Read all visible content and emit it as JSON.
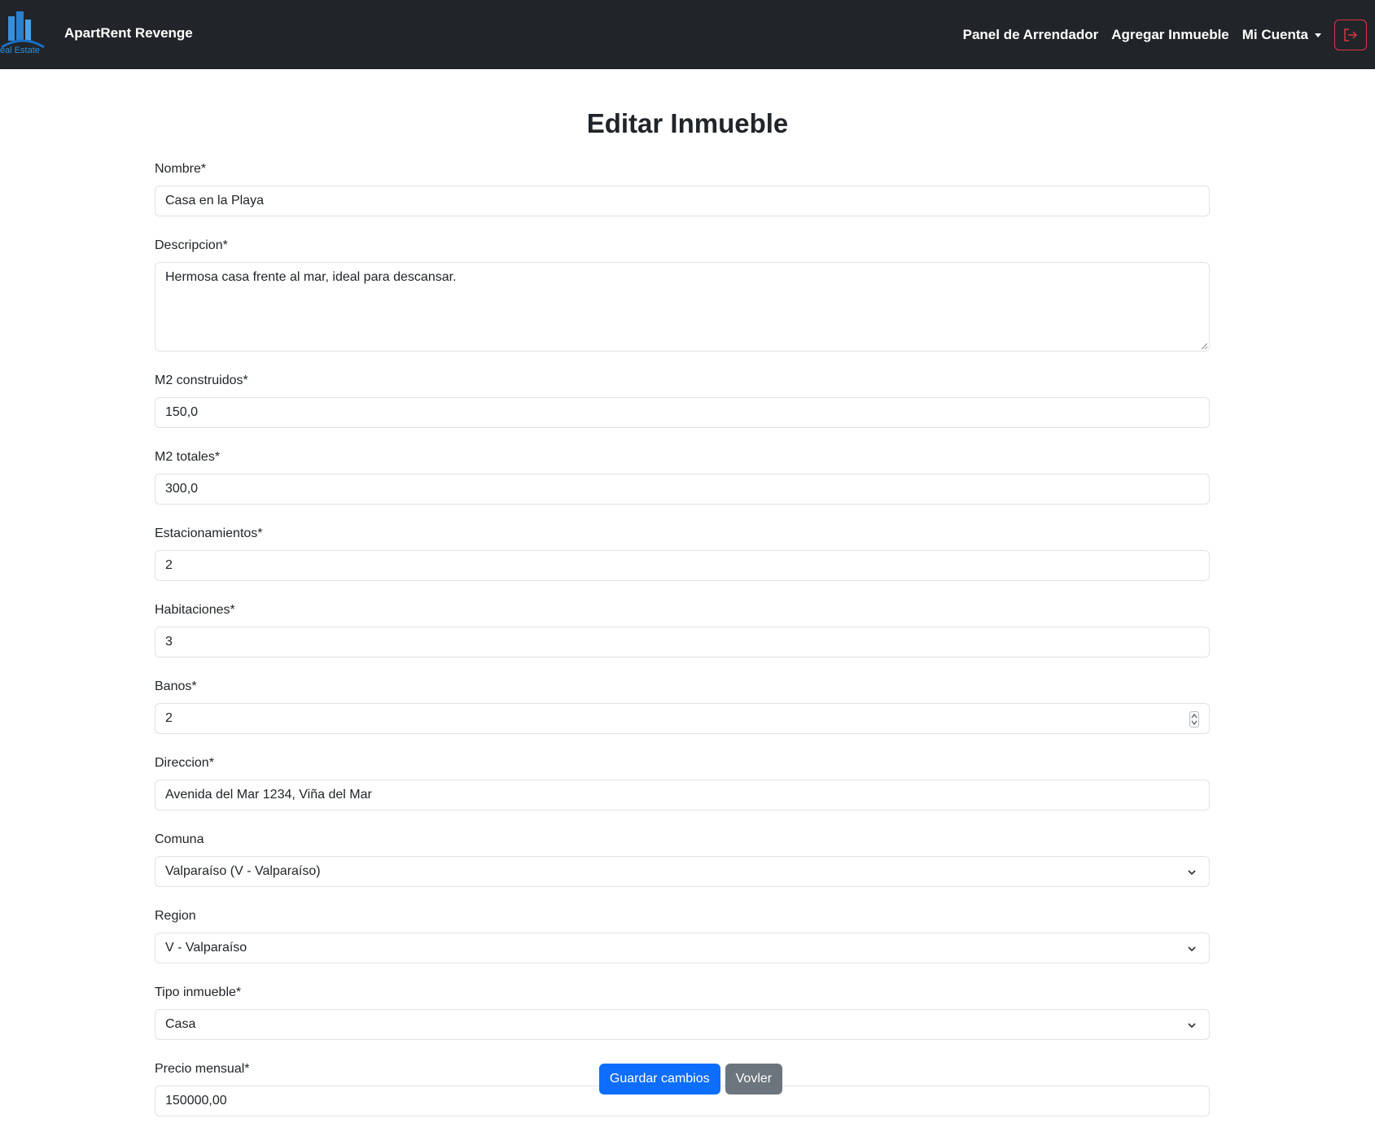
{
  "navbar": {
    "brand": "ApartRent Revenge",
    "logo_text": "Real Estate",
    "links": [
      {
        "label": "Panel de Arrendador"
      },
      {
        "label": "Agregar Inmueble"
      },
      {
        "label": "Mi Cuenta"
      }
    ],
    "logout_icon": "logout-icon",
    "logout_color": "#dc3545"
  },
  "page": {
    "title": "Editar Inmueble"
  },
  "form": {
    "nombre": {
      "label": "Nombre*",
      "value": "Casa en la Playa"
    },
    "descripcion": {
      "label": "Descripcion*",
      "value": "Hermosa casa frente al mar, ideal para descansar."
    },
    "m2_construidos": {
      "label": "M2 construidos*",
      "value": "150,0"
    },
    "m2_totales": {
      "label": "M2 totales*",
      "value": "300,0"
    },
    "estacionamientos": {
      "label": "Estacionamientos*",
      "value": "2"
    },
    "habitaciones": {
      "label": "Habitaciones*",
      "value": "3"
    },
    "banos": {
      "label": "Banos*",
      "value": "2"
    },
    "direccion": {
      "label": "Direccion*",
      "value": "Avenida del Mar 1234, Viña del Mar"
    },
    "comuna": {
      "label": "Comuna",
      "value": "Valparaíso (V - Valparaíso)"
    },
    "region": {
      "label": "Region",
      "value": "V - Valparaíso"
    },
    "tipo_inmueble": {
      "label": "Tipo inmueble*",
      "value": "Casa"
    },
    "precio_mensual": {
      "label": "Precio mensual*",
      "value": "150000,00"
    }
  },
  "buttons": {
    "save": "Guardar cambios",
    "back": "Vovler"
  },
  "colors": {
    "navbar_bg": "#212529",
    "primary": "#0d6efd",
    "secondary": "#6c757d"
  }
}
